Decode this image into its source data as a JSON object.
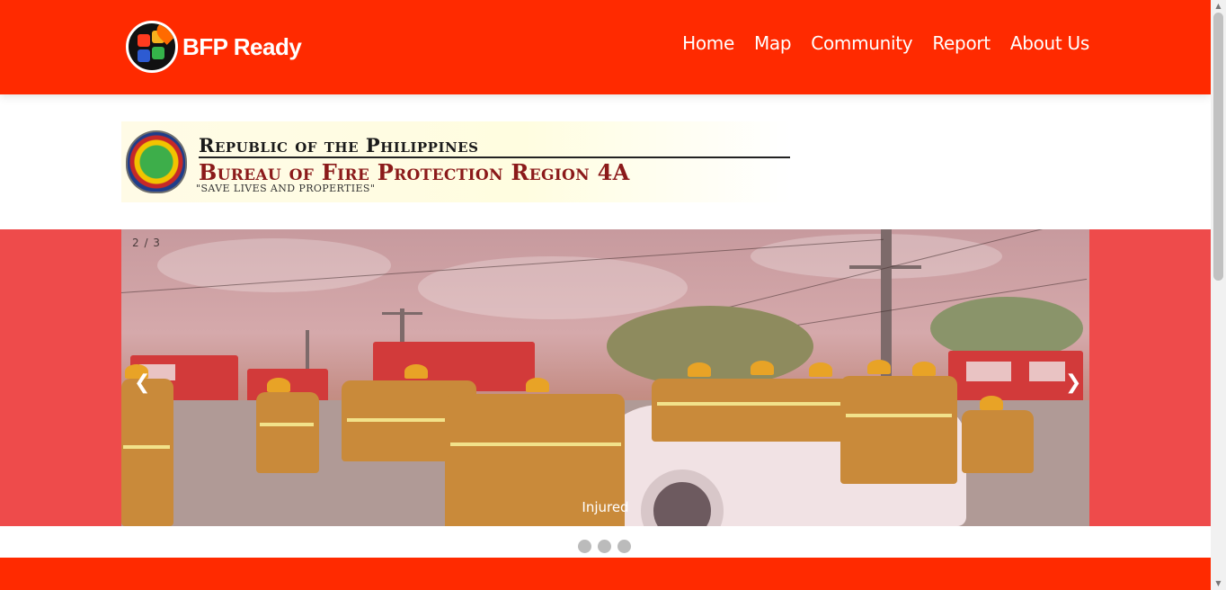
{
  "brand": {
    "name": "BFP Ready",
    "logo_icon": "bfp-ready-logo-icon"
  },
  "nav": {
    "items": [
      {
        "label": "Home"
      },
      {
        "label": "Map"
      },
      {
        "label": "Community"
      },
      {
        "label": "Report"
      },
      {
        "label": "About Us"
      }
    ]
  },
  "banner": {
    "line1": "Republic of the Philippines",
    "line2": "Bureau of Fire Protection Region 4A",
    "line3": "\"SAVE LIVES AND PROPERTIES\""
  },
  "slideshow": {
    "number_text": "2 / 3",
    "caption": "Injured",
    "prev_label": "❮",
    "next_label": "❯",
    "total_slides": 3,
    "active_slide": 2
  },
  "colors": {
    "navbar": "#ff2a00",
    "slideshow_bg": "#ee4b4b",
    "dot": "#bbbbbb"
  }
}
